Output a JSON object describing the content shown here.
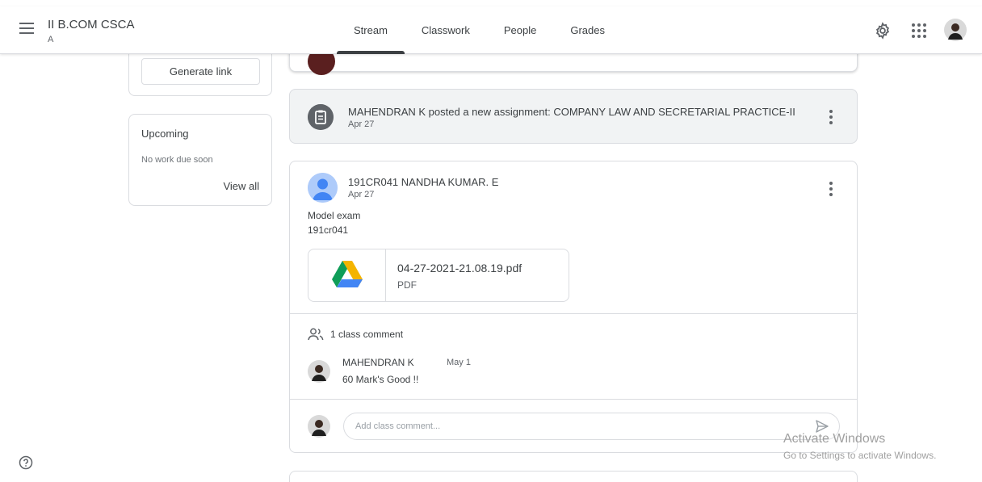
{
  "header": {
    "class_title": "II B.COM CSCA",
    "class_section": "A",
    "tabs": [
      {
        "label": "Stream",
        "active": true
      },
      {
        "label": "Classwork",
        "active": false
      },
      {
        "label": "People",
        "active": false
      },
      {
        "label": "Grades",
        "active": false
      }
    ]
  },
  "sidebar": {
    "generate_link_label": "Generate link",
    "upcoming": {
      "title": "Upcoming",
      "empty_text": "No work due soon",
      "view_all_label": "View all"
    }
  },
  "stream": {
    "assignment_notice": {
      "text": "MAHENDRAN K posted a new assignment: COMPANY LAW AND SECRETARIAL PRACTICE-II",
      "date": "Apr 27"
    },
    "post": {
      "author": "191CR041 NANDHA KUMAR. E",
      "date": "Apr 27",
      "body_lines": [
        "Model exam",
        "191cr041"
      ],
      "attachment": {
        "name": "04-27-2021-21.08.19.pdf",
        "type": "PDF"
      },
      "comment_count_label": "1 class comment",
      "comments": [
        {
          "author": "MAHENDRAN K",
          "date": "May 1",
          "text": "60 Mark's Good !!"
        }
      ],
      "comment_placeholder": "Add class comment..."
    }
  },
  "watermark": {
    "title": "Activate Windows",
    "subtitle": "Go to Settings to activate Windows."
  },
  "colors": {
    "accent": "#3c4043",
    "border": "#dadce0",
    "muted_text": "#5f6368",
    "notice_bg": "#f1f3f4",
    "drive_green": "#0f9d58",
    "drive_blue": "#4285f4",
    "drive_yellow": "#f4b400"
  }
}
